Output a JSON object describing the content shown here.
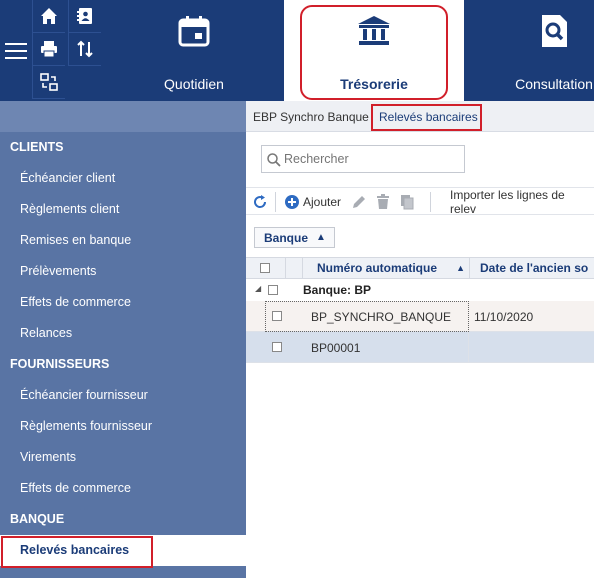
{
  "ribbon": {
    "tabs": [
      {
        "label": "Quotidien",
        "icon": "calendar-icon"
      },
      {
        "label": "Trésorerie",
        "icon": "bank-icon"
      },
      {
        "label": "Consultation",
        "icon": "search-doc-icon"
      }
    ],
    "mini_icons": [
      "home-icon",
      "address-book-icon",
      "print-icon",
      "sync-icon",
      "sort-icon"
    ]
  },
  "sidebar": {
    "sections": [
      {
        "title": "CLIENTS",
        "items": [
          "Échéancier client",
          "Règlements client",
          "Remises en banque",
          "Prélèvements",
          "Effets de commerce",
          "Relances"
        ]
      },
      {
        "title": "FOURNISSEURS",
        "items": [
          "Échéancier fournisseur",
          "Règlements fournisseur",
          "Virements",
          "Effets de commerce"
        ]
      },
      {
        "title": "BANQUE",
        "items": [
          "Relevés bancaires"
        ]
      }
    ]
  },
  "breadcrumb": {
    "first": "EBP Synchro Banque",
    "current": "Relevés bancaires"
  },
  "search": {
    "placeholder": "Rechercher"
  },
  "toolbar": {
    "add_label": "Ajouter",
    "import_label": "Importer les lignes de relev"
  },
  "group_by": {
    "label": "Banque"
  },
  "grid": {
    "columns": [
      "Numéro automatique",
      "Date de l'ancien so"
    ],
    "group_title": "Banque: BP",
    "rows": [
      {
        "num": "BP_SYNCHRO_BANQUE",
        "date": "11/10/2020"
      },
      {
        "num": "BP00001",
        "date": ""
      }
    ]
  },
  "colors": {
    "brand": "#1b3c78",
    "sidebar": "#5974a4",
    "highlight": "#d11f2a"
  }
}
